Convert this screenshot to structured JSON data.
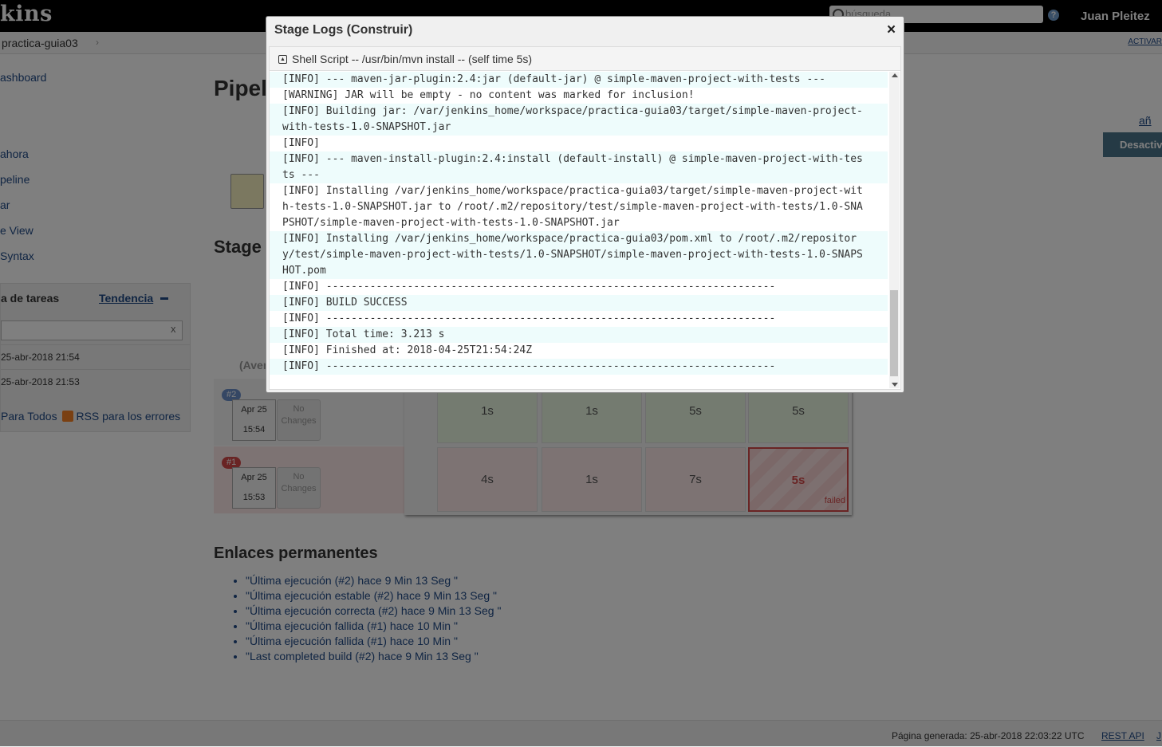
{
  "header": {
    "logo": "kins",
    "search_placeholder": "búsqueda",
    "help": "?",
    "user": "Juan Pleitez"
  },
  "breadcrumb": {
    "item": "practica-guia03",
    "chevron": "›",
    "right_link": "ACTIVAR"
  },
  "sidebar": {
    "links": [
      "ashboard",
      "ahora",
      "peline",
      "ar",
      "e View",
      "Syntax"
    ],
    "build_history": {
      "title": "a de tareas",
      "trend": "Tendencia",
      "filter_clear": "x",
      "rows": [
        "25-abr-2018 21:54",
        "25-abr-2018 21:53"
      ],
      "rss_all": "Para Todos",
      "rss_failures": "RSS para los errores"
    }
  },
  "main": {
    "title": "Pipel",
    "stage_heading": "Stage",
    "add_description": "añ",
    "disable_button": "Desactiva",
    "average_label": "(Aver",
    "runs": [
      {
        "badge": "#2",
        "date": "Apr 25",
        "time": "15:54",
        "changes_1": "No",
        "changes_2": "Changes",
        "status": "success",
        "durations": [
          "1s",
          "1s",
          "5s",
          "5s"
        ]
      },
      {
        "badge": "#1",
        "date": "Apr 25",
        "time": "15:53",
        "changes_1": "No",
        "changes_2": "Changes",
        "status": "failed",
        "durations": [
          "4s",
          "1s",
          "7s",
          "5s"
        ]
      }
    ],
    "failed_label": "failed",
    "permalinks_title": "Enlaces permanentes",
    "permalinks": [
      "\"Última ejecución (#2) hace 9 Min 13 Seg \"",
      "\"Última ejecución estable (#2) hace 9 Min 13 Seg \"",
      "\"Última ejecución correcta (#2) hace 9 Min 13 Seg \"",
      "\"Última ejecución fallida (#1) hace 10 Min \"",
      "\"Última ejecución fallida (#1) hace 10 Min \"",
      "\"Last completed build (#2) hace 9 Min 13 Seg \""
    ]
  },
  "footer": {
    "generated": "Página generada: 25-abr-2018 22:03:22 UTC",
    "rest_api": "REST API",
    "extra": "J"
  },
  "modal": {
    "title": "Stage Logs (Construir)",
    "close": "×",
    "step_title": "Shell Script -- /usr/bin/mvn install -- (self time 5s)",
    "log_lines": [
      "[INFO] --- maven-jar-plugin:2.4:jar (default-jar) @ simple-maven-project-with-tests ---",
      "[WARNING] JAR will be empty - no content was marked for inclusion!",
      "[INFO] Building jar: /var/jenkins_home/workspace/practica-guia03/target/simple-maven-project-",
      "with-tests-1.0-SNAPSHOT.jar",
      "[INFO]",
      "[INFO] --- maven-install-plugin:2.4:install (default-install) @ simple-maven-project-with-tes",
      "ts ---",
      "[INFO] Installing /var/jenkins_home/workspace/practica-guia03/target/simple-maven-project-wit",
      "h-tests-1.0-SNAPSHOT.jar to /root/.m2/repository/test/simple-maven-project-with-tests/1.0-SNA",
      "PSHOT/simple-maven-project-with-tests-1.0-SNAPSHOT.jar",
      "[INFO] Installing /var/jenkins_home/workspace/practica-guia03/pom.xml to /root/.m2/repositor",
      "y/test/simple-maven-project-with-tests/1.0-SNAPSHOT/simple-maven-project-with-tests-1.0-SNAPS",
      "HOT.pom",
      "[INFO] ------------------------------------------------------------------------",
      "[INFO] BUILD SUCCESS",
      "[INFO] ------------------------------------------------------------------------",
      "[INFO] Total time: 3.213 s",
      "[INFO] Finished at: 2018-04-25T21:54:24Z",
      "[INFO] ------------------------------------------------------------------------"
    ]
  },
  "colors": {
    "success_badge": "#6a8ec9",
    "failed_badge": "#d24949",
    "header_bg": "#000000",
    "failed_border": "#d24949"
  }
}
